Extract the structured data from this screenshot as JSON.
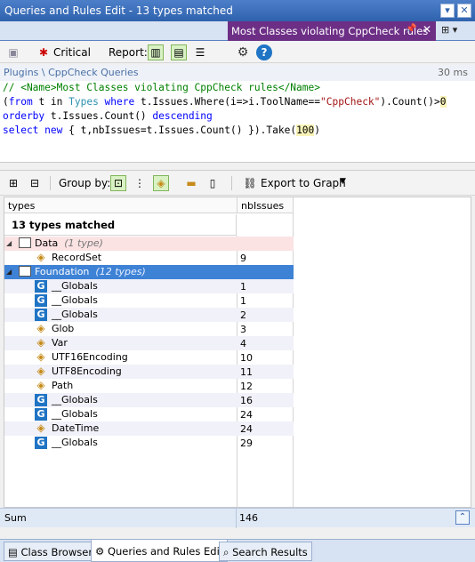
{
  "window": {
    "title": "Queries and Rules Edit  -  13 types matched",
    "doc_tab": "Most Classes violating CppCheck rules"
  },
  "toolbar": {
    "critical_label": "Critical",
    "report_label": "Report:"
  },
  "breadcrumb": {
    "path": "Plugins \\ CppCheck Queries",
    "duration": "30 ms"
  },
  "query": {
    "line1_comment": "// <Name>Most Classes violating CppCheck rules</Name>",
    "line2": {
      "open": "(",
      "from": "from",
      "t_in": " t in ",
      "types": "Types",
      "where": " where",
      "mid": " t.Issues.Where(i=>i.ToolName==",
      "str": "\"CppCheck\"",
      "tail": ").Count()>",
      "zero": "0"
    },
    "line3": {
      "orderby": "orderby",
      "rest": " t.Issues.Count() ",
      "descending": "descending"
    },
    "line4": {
      "select": "select",
      "new_kw": " new",
      "rest": " { t,nbIssues=t.Issues.Count() }).Take(",
      "num": "100",
      "close": ")"
    }
  },
  "grouping": {
    "group_by_label": "Group by:",
    "export_label": "Export to Graph"
  },
  "grid": {
    "columns": [
      "types",
      "nbIssues"
    ],
    "matched_label": "13 types matched",
    "rows": [
      {
        "name": "Data",
        "suffix": "(1 type)",
        "value": "",
        "kind": "namespace"
      },
      {
        "name": "RecordSet",
        "suffix": "",
        "value": "9",
        "kind": "class"
      },
      {
        "name": "Foundation",
        "suffix": "(12 types)",
        "value": "",
        "kind": "namespace"
      },
      {
        "name": "__Globals",
        "suffix": "",
        "value": "1",
        "kind": "globals"
      },
      {
        "name": "__Globals",
        "suffix": "",
        "value": "1",
        "kind": "globals"
      },
      {
        "name": "__Globals",
        "suffix": "",
        "value": "2",
        "kind": "globals"
      },
      {
        "name": "Glob",
        "suffix": "",
        "value": "3",
        "kind": "class"
      },
      {
        "name": "Var",
        "suffix": "",
        "value": "4",
        "kind": "class"
      },
      {
        "name": "UTF16Encoding",
        "suffix": "",
        "value": "10",
        "kind": "class"
      },
      {
        "name": "UTF8Encoding",
        "suffix": "",
        "value": "11",
        "kind": "class"
      },
      {
        "name": "Path",
        "suffix": "",
        "value": "12",
        "kind": "class"
      },
      {
        "name": "__Globals",
        "suffix": "",
        "value": "16",
        "kind": "globals"
      },
      {
        "name": "__Globals",
        "suffix": "",
        "value": "24",
        "kind": "globals"
      },
      {
        "name": "DateTime",
        "suffix": "",
        "value": "24",
        "kind": "class"
      },
      {
        "name": "__Globals",
        "suffix": "",
        "value": "29",
        "kind": "globals"
      }
    ],
    "sum_label": "Sum",
    "sum_value": "146"
  },
  "bottom_tabs": [
    "Class Browser",
    "Queries and Rules Edit",
    "Search Results"
  ],
  "colors": {
    "title_bar": "#2f62ad",
    "doc_tab": "#6d2f86",
    "selection": "#3e82d6"
  }
}
